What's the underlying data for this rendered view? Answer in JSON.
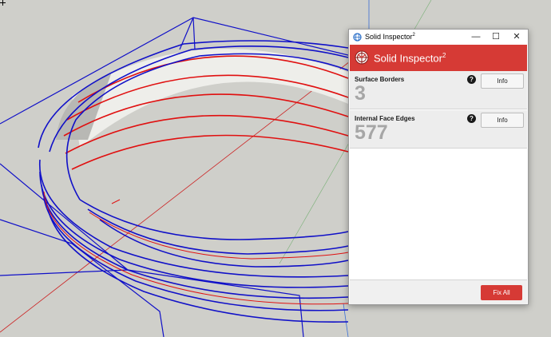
{
  "window": {
    "title": "Solid Inspector",
    "title_superscript": "2",
    "minimize_glyph": "—",
    "maximize_glyph": "☐",
    "close_glyph": "✕"
  },
  "header": {
    "title": "Solid Inspector",
    "title_superscript": "2",
    "color": "#d63a35"
  },
  "sections": [
    {
      "label": "Surface Borders",
      "count": "3",
      "help_glyph": "?",
      "button": "Info"
    },
    {
      "label": "Internal Face Edges",
      "count": "577",
      "help_glyph": "?",
      "button": "Info"
    }
  ],
  "footer": {
    "button": "Fix All"
  },
  "viewport": {
    "background": "#cfcfca",
    "edge_color": "#1010c8",
    "highlight_color": "#e01010"
  }
}
